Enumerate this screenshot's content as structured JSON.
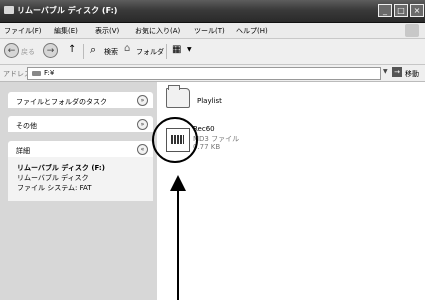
{
  "window": {
    "title": "リムーバブル ディスク (F:)",
    "min_symbol": "_",
    "max_symbol": "□",
    "close_symbol": "×"
  },
  "menu": [
    "ファイル(F)",
    "編集(E)",
    "表示(V)",
    "お気に入り(A)",
    "ツール(T)",
    "ヘルプ(H)"
  ],
  "toolbar": {
    "back_label": "戻る",
    "back_symbol": "←",
    "forward_symbol": "→",
    "up_symbol": "↑",
    "search_label": "検索",
    "search_symbol": "⌕",
    "folders_label": "フォルダ",
    "view_symbol": "▦"
  },
  "address": {
    "label": "アドレス(D)",
    "path": "F:¥",
    "go_label": "移動",
    "go_symbol": "→",
    "dropdown_symbol": "▼"
  },
  "left_pane": {
    "tasks_title": "ファイルとフォルダのタスク",
    "other_title": "その他",
    "details_title": "詳細",
    "collapse_symbol": "»",
    "expand_symbol": "«",
    "details": {
      "name": "リムーバブル ディスク (F:)",
      "type": "リムーバブル ディスク",
      "filesystem": "ファイル システム: FAT"
    }
  },
  "items": [
    {
      "name": "Playlist",
      "icon": "folder-icon"
    },
    {
      "name": "Rec60",
      "type": "MD3 ファイル",
      "size": "0.77 KB",
      "icon": "document-icon"
    }
  ]
}
